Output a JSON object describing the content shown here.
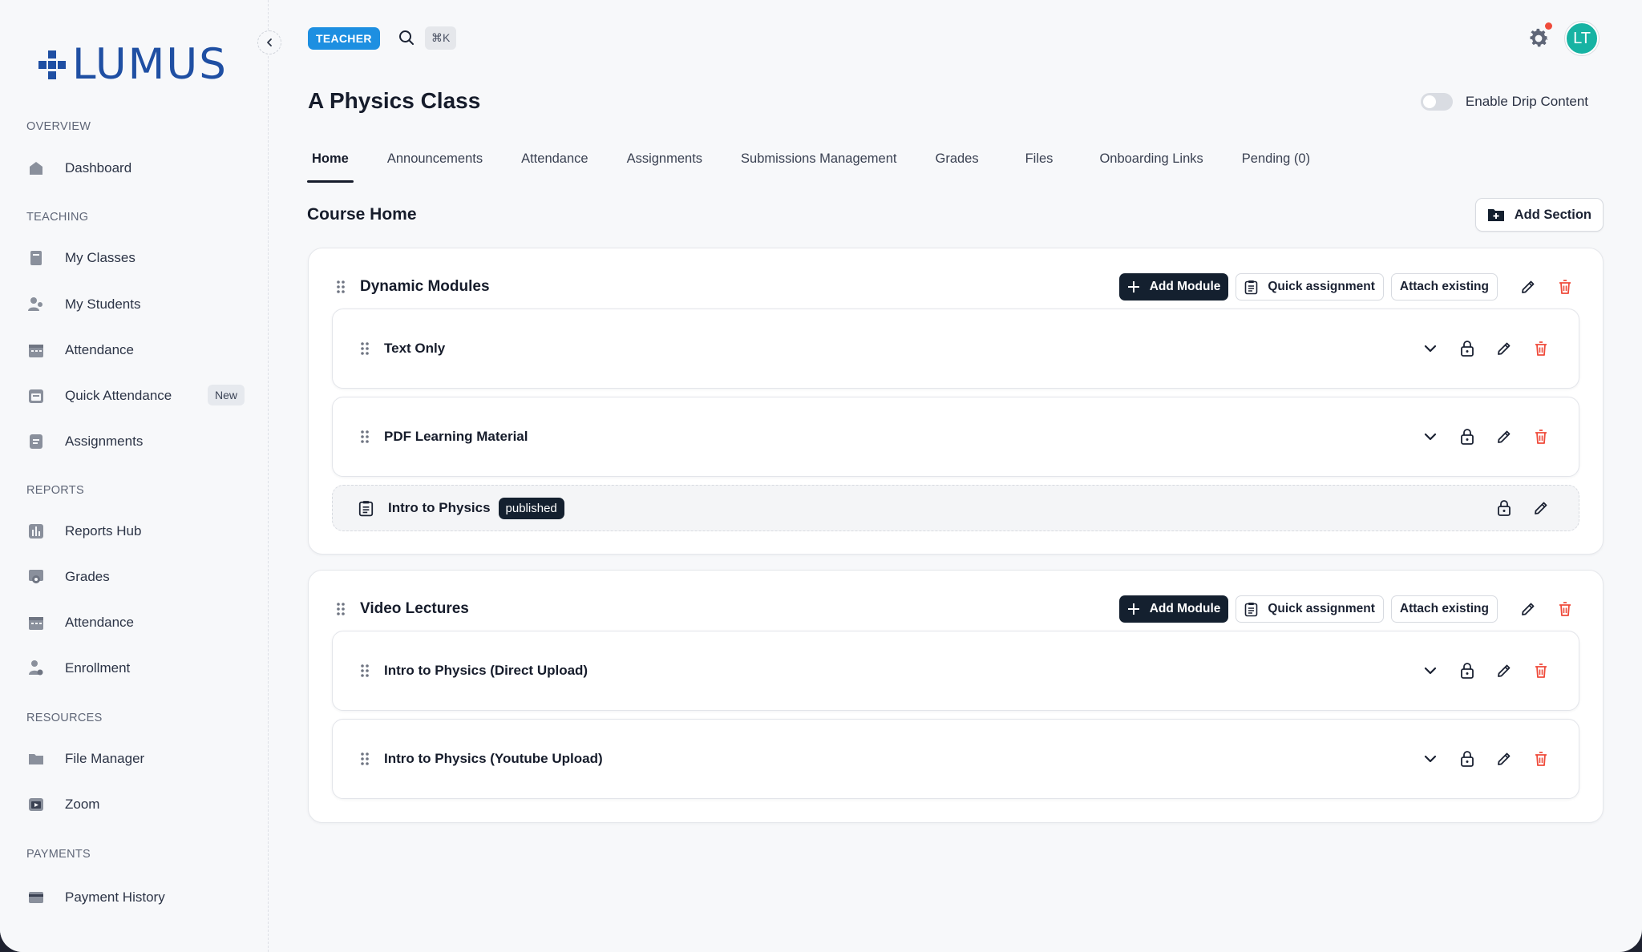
{
  "brand": {
    "name": "LUMUS",
    "color": "#1f4fa3"
  },
  "sidebar": {
    "sections": [
      {
        "title": "OVERVIEW",
        "items": [
          {
            "label": "Dashboard",
            "icon": "home-icon"
          }
        ]
      },
      {
        "title": "TEACHING",
        "items": [
          {
            "label": "My Classes",
            "icon": "book-icon"
          },
          {
            "label": "My Students",
            "icon": "users-icon"
          },
          {
            "label": "Attendance",
            "icon": "calendar-icon"
          },
          {
            "label": "Quick Attendance",
            "icon": "clock-calendar-icon",
            "badge": "New"
          },
          {
            "label": "Assignments",
            "icon": "document-icon"
          }
        ]
      },
      {
        "title": "REPORTS",
        "items": [
          {
            "label": "Reports Hub",
            "icon": "bar-chart-icon"
          },
          {
            "label": "Grades",
            "icon": "certificate-icon"
          },
          {
            "label": "Attendance",
            "icon": "calendar-icon"
          },
          {
            "label": "Enrollment",
            "icon": "user-gear-icon"
          }
        ]
      },
      {
        "title": "RESOURCES",
        "items": [
          {
            "label": "File Manager",
            "icon": "folder-icon"
          },
          {
            "label": "Zoom",
            "icon": "video-icon"
          }
        ]
      },
      {
        "title": "PAYMENTS",
        "items": [
          {
            "label": "Payment History",
            "icon": "credit-card-icon"
          }
        ]
      }
    ]
  },
  "header": {
    "role": "TEACHER",
    "shortcut": "⌘K",
    "avatar_initials": "LT",
    "avatar_color": "#17b3a3",
    "notification_color": "#ef4b3b"
  },
  "page": {
    "title": "A Physics Class",
    "drip_label": "Enable Drip Content",
    "drip_enabled": false
  },
  "tabs": [
    "Home",
    "Announcements",
    "Attendance",
    "Assignments",
    "Submissions Management",
    "Grades",
    "Files",
    "Onboarding Links",
    "Pending (0)"
  ],
  "active_tab": "Home",
  "course": {
    "heading": "Course Home",
    "add_section_label": "Add Section",
    "add_module_label": "Add Module",
    "quick_assignment_label": "Quick assignment",
    "attach_existing_label": "Attach existing",
    "sections": [
      {
        "title": "Dynamic Modules",
        "modules": [
          {
            "title": "Text Only"
          },
          {
            "title": "PDF Learning Material"
          }
        ],
        "assignment": {
          "title": "Intro to Physics",
          "status": "published"
        }
      },
      {
        "title": "Video Lectures",
        "modules": [
          {
            "title": "Intro to Physics (Direct Upload)"
          },
          {
            "title": "Intro to Physics (Youtube Upload)"
          }
        ]
      }
    ]
  },
  "colors": {
    "danger": "#ef4b3b",
    "primary_dark": "#14202f",
    "accent_blue": "#1d8fe1"
  }
}
